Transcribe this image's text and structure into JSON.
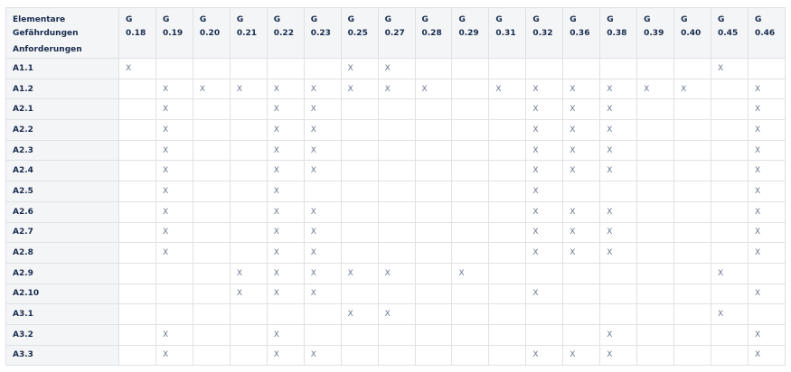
{
  "header": {
    "corner_top": "Elementare Gefährdungen",
    "corner_bottom": "Anforderungen",
    "columns": [
      [
        "G",
        "0.18"
      ],
      [
        "G",
        "0.19"
      ],
      [
        "G",
        "0.20"
      ],
      [
        "G",
        "0.21"
      ],
      [
        "G",
        "0.22"
      ],
      [
        "G",
        "0.23"
      ],
      [
        "G",
        "0.25"
      ],
      [
        "G",
        "0.27"
      ],
      [
        "G",
        "0.28"
      ],
      [
        "G",
        "0.29"
      ],
      [
        "G",
        "0.31"
      ],
      [
        "G",
        "0.32"
      ],
      [
        "G",
        "0.36"
      ],
      [
        "G",
        "0.38"
      ],
      [
        "G",
        "0.39"
      ],
      [
        "G",
        "0.40"
      ],
      [
        "G",
        "0.45"
      ],
      [
        "G",
        "0.46"
      ]
    ]
  },
  "rows": [
    {
      "label": "A1.1",
      "cells": [
        "X",
        "",
        "",
        "",
        "",
        "",
        "X",
        "X",
        "",
        "",
        "",
        "",
        "",
        "",
        "",
        "",
        "X",
        ""
      ]
    },
    {
      "label": "A1.2",
      "cells": [
        "",
        "X",
        "X",
        "X",
        "X",
        "X",
        "X",
        "X",
        "X",
        "",
        "X",
        "X",
        "X",
        "X",
        "X",
        "X",
        "",
        "X"
      ]
    },
    {
      "label": "A2.1",
      "cells": [
        "",
        "X",
        "",
        "",
        "X",
        "X",
        "",
        "",
        "",
        "",
        "",
        "X",
        "X",
        "X",
        "",
        "",
        "",
        "X"
      ]
    },
    {
      "label": "A2.2",
      "cells": [
        "",
        "X",
        "",
        "",
        "X",
        "X",
        "",
        "",
        "",
        "",
        "",
        "X",
        "X",
        "X",
        "",
        "",
        "",
        "X"
      ]
    },
    {
      "label": "A2.3",
      "cells": [
        "",
        "X",
        "",
        "",
        "X",
        "X",
        "",
        "",
        "",
        "",
        "",
        "X",
        "X",
        "X",
        "",
        "",
        "",
        "X"
      ]
    },
    {
      "label": "A2.4",
      "cells": [
        "",
        "X",
        "",
        "",
        "X",
        "X",
        "",
        "",
        "",
        "",
        "",
        "X",
        "X",
        "X",
        "",
        "",
        "",
        "X"
      ]
    },
    {
      "label": "A2.5",
      "cells": [
        "",
        "X",
        "",
        "",
        "X",
        "",
        "",
        "",
        "",
        "",
        "",
        "X",
        "",
        "",
        "",
        "",
        "",
        "X"
      ]
    },
    {
      "label": "A2.6",
      "cells": [
        "",
        "X",
        "",
        "",
        "X",
        "X",
        "",
        "",
        "",
        "",
        "",
        "X",
        "X",
        "X",
        "",
        "",
        "",
        "X"
      ]
    },
    {
      "label": "A2.7",
      "cells": [
        "",
        "X",
        "",
        "",
        "X",
        "X",
        "",
        "",
        "",
        "",
        "",
        "X",
        "X",
        "X",
        "",
        "",
        "",
        "X"
      ]
    },
    {
      "label": "A2.8",
      "cells": [
        "",
        "X",
        "",
        "",
        "X",
        "X",
        "",
        "",
        "",
        "",
        "",
        "X",
        "X",
        "X",
        "",
        "",
        "",
        "X"
      ]
    },
    {
      "label": "A2.9",
      "cells": [
        "",
        "",
        "",
        "X",
        "X",
        "X",
        "X",
        "X",
        "",
        "X",
        "",
        "",
        "",
        "",
        "",
        "",
        "X",
        ""
      ]
    },
    {
      "label": "A2.10",
      "cells": [
        "",
        "",
        "",
        "X",
        "X",
        "X",
        "",
        "",
        "",
        "",
        "",
        "X",
        "",
        "",
        "",
        "",
        "",
        "X"
      ]
    },
    {
      "label": "A3.1",
      "cells": [
        "",
        "",
        "",
        "",
        "",
        "",
        "X",
        "X",
        "",
        "",
        "",
        "",
        "",
        "",
        "",
        "",
        "X",
        ""
      ]
    },
    {
      "label": "A3.2",
      "cells": [
        "",
        "X",
        "",
        "",
        "X",
        "",
        "",
        "",
        "",
        "",
        "",
        "",
        "",
        "X",
        "",
        "",
        "",
        "X"
      ]
    },
    {
      "label": "A3.3",
      "cells": [
        "",
        "X",
        "",
        "",
        "X",
        "X",
        "",
        "",
        "",
        "",
        "",
        "X",
        "X",
        "X",
        "",
        "",
        "",
        "X"
      ]
    }
  ],
  "colors": {
    "header_bg": "#f4f5f7",
    "border": "#dfe1e6",
    "text": "#172b4d",
    "mark": "#6b778c"
  }
}
